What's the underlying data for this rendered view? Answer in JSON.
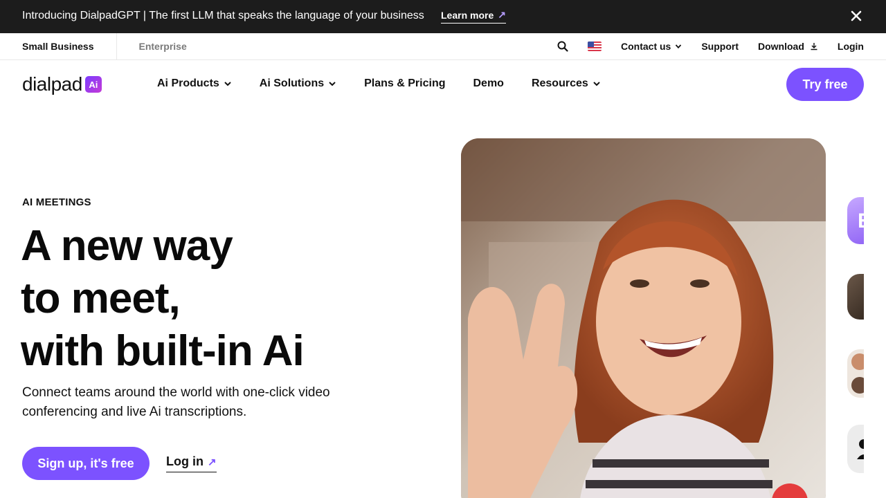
{
  "announcement": {
    "text": "Introducing DialpadGPT | The first LLM that speaks the language of your business",
    "link_label": "Learn more",
    "link_icon": "arrow-up-right-icon",
    "close_icon": "close-icon"
  },
  "utility_bar": {
    "segments": [
      "Small Business",
      "Enterprise"
    ],
    "search_icon": "search-icon",
    "flag_icon": "us-flag-icon",
    "contact_label": "Contact us",
    "support_label": "Support",
    "download_label": "Download",
    "login_label": "Login"
  },
  "nav": {
    "logo_text": "dialpad",
    "logo_badge": "Ai",
    "items": [
      "Ai Products",
      "Ai Solutions",
      "Plans & Pricing",
      "Demo",
      "Resources"
    ],
    "try_free_label": "Try free"
  },
  "hero": {
    "eyebrow": "AI MEETINGS",
    "headline": [
      "A new way",
      "to meet,",
      "with built-in Ai"
    ],
    "subtext": "Connect teams around the world with one-click video conferencing and live Ai transcriptions.",
    "signup_label": "Sign up, it's free",
    "login_label": "Log in"
  },
  "side_thumbnails": {
    "first_letter": "E"
  },
  "colors": {
    "accent": "#7c52ff",
    "announcement_bg": "#1c1c1c"
  }
}
